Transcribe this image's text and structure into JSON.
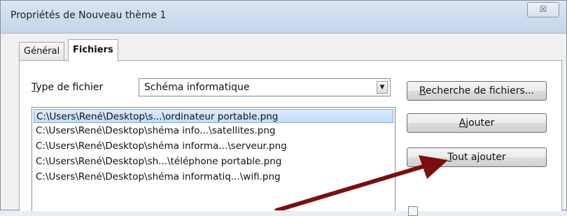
{
  "window": {
    "title": "Propriétés de Nouveau thème 1",
    "close_glyph": "☒"
  },
  "tabs": [
    {
      "label": "Général",
      "active": false
    },
    {
      "label": "Fichiers",
      "active": true
    }
  ],
  "file_type": {
    "label_first": "T",
    "label_rest": "ype de fichier",
    "selected_value": "Schéma informatique",
    "dropdown_icon": "dropdown-arrow-icon"
  },
  "file_list": [
    {
      "path": "C:\\Users\\René\\Desktop\\s...\\ordinateur portable.png",
      "selected": true
    },
    {
      "path": "C:\\Users\\René\\Desktop\\shéma info...\\satellites.png",
      "selected": false
    },
    {
      "path": "C:\\Users\\René\\Desktop\\shéma informa...\\serveur.png",
      "selected": false
    },
    {
      "path": "C:\\Users\\René\\Desktop\\sh...\\téléphone portable.png",
      "selected": false
    },
    {
      "path": "C:\\Users\\René\\Desktop\\shéma informatiq...\\wifi.png",
      "selected": false
    }
  ],
  "buttons": {
    "find_files": {
      "mnemonic": "R",
      "rest": "echerche de fichiers..."
    },
    "add": {
      "mnemonic": "A",
      "rest": "jouter"
    },
    "add_all": {
      "mnemonic": "T",
      "rest": "out ajouter"
    }
  },
  "annotation": {
    "arrow_color": "#7a0f0f"
  }
}
